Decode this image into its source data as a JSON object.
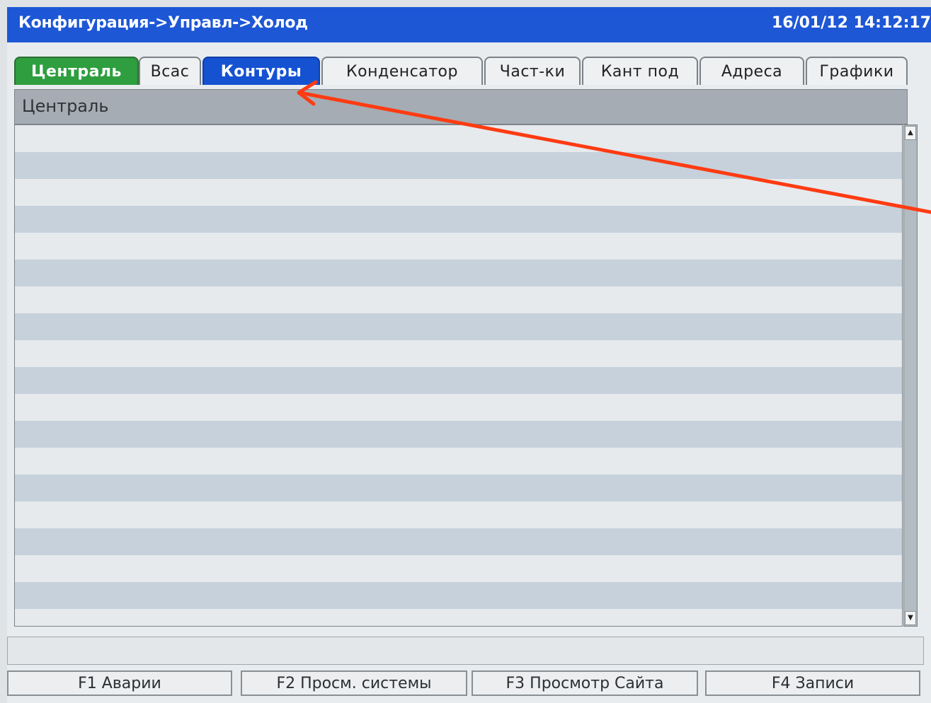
{
  "header": {
    "breadcrumb": "Конфигурация->Управл->Холод",
    "datetime": "16/01/12 14:12:17"
  },
  "tabs": [
    {
      "label": "Централь",
      "state": "green"
    },
    {
      "label": "Всас",
      "state": "normal"
    },
    {
      "label": "Контуры",
      "state": "selected"
    },
    {
      "label": "Конденсатор",
      "state": "normal"
    },
    {
      "label": "Част-ки",
      "state": "normal"
    },
    {
      "label": "Кант под",
      "state": "normal"
    },
    {
      "label": "Адреса",
      "state": "normal"
    },
    {
      "label": "Графики",
      "state": "normal"
    }
  ],
  "panel": {
    "title": "Централь"
  },
  "function_keys": [
    {
      "label": "F1 Аварии"
    },
    {
      "label": "F2 Просм. системы"
    },
    {
      "label": "F3 Просмотр Сайта"
    },
    {
      "label": "F4 Записи"
    }
  ],
  "icons": {
    "scroll_up": "triangle-up",
    "scroll_down": "triangle-down",
    "annotation": "red-arrow"
  },
  "colors": {
    "title_bar": "#1d57d6",
    "tab_green": "#2e9e3f",
    "tab_selected": "#1552d2",
    "annotation_arrow": "#ff3b12"
  }
}
